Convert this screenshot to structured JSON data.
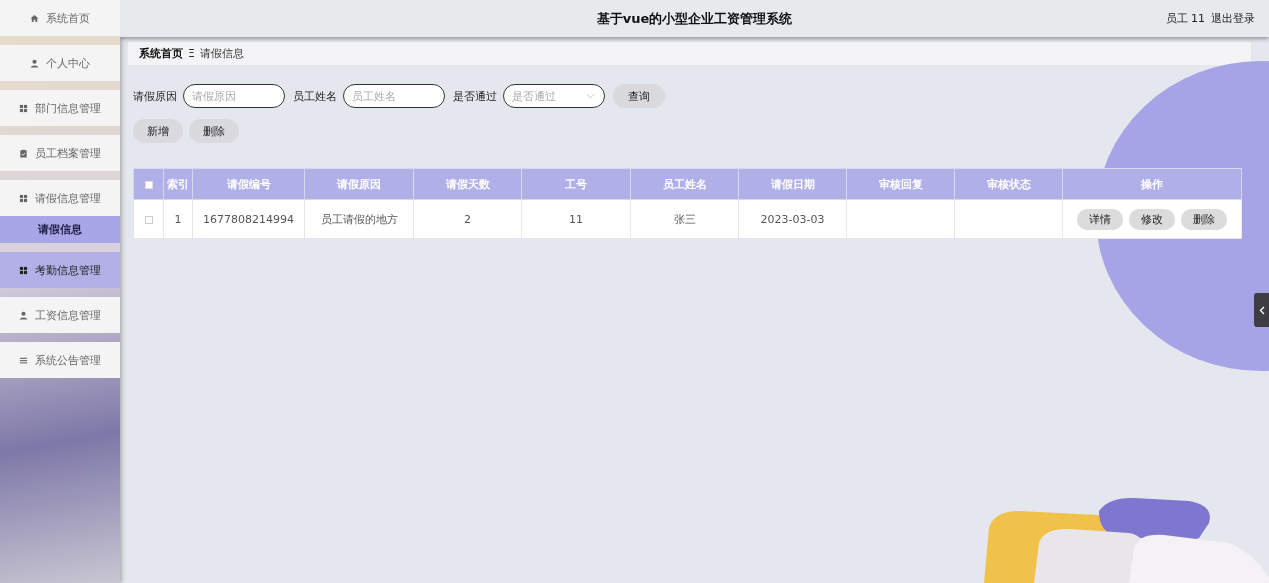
{
  "header": {
    "title": "基于vue的小型企业工资管理系统",
    "user": "员工 11",
    "logout": "退出登录"
  },
  "sidebar": {
    "items": [
      {
        "label": "系统首页",
        "kind": "home",
        "hovered": false
      },
      {
        "label": "个人中心",
        "kind": "person",
        "hovered": false
      },
      {
        "label": "部门信息管理",
        "kind": "grid",
        "hovered": false
      },
      {
        "label": "员工档案管理",
        "kind": "clipboard",
        "hovered": false
      },
      {
        "label": "请假信息管理",
        "kind": "grid",
        "hovered": false,
        "children": [
          {
            "label": "请假信息",
            "selected": true
          }
        ]
      },
      {
        "label": "考勤信息管理",
        "kind": "grid",
        "hovered": true
      },
      {
        "label": "工资信息管理",
        "kind": "person",
        "hovered": false
      },
      {
        "label": "系统公告管理",
        "kind": "list",
        "hovered": false
      }
    ]
  },
  "breadcrumb": {
    "items": [
      "系统首页",
      "请假信息"
    ],
    "separator": "Ξ"
  },
  "filters": [
    {
      "label": "请假原因",
      "kind": "text",
      "placeholder": "请假原因"
    },
    {
      "label": "员工姓名",
      "kind": "text",
      "placeholder": "员工姓名"
    },
    {
      "label": "是否通过",
      "kind": "select",
      "placeholder": "是否通过"
    }
  ],
  "search_button": "查询",
  "actions": [
    "新增",
    "删除"
  ],
  "table": {
    "all_checked": false,
    "columns": [
      "索引",
      "请假编号",
      "请假原因",
      "请假天数",
      "工号",
      "员工姓名",
      "请假日期",
      "审核回复",
      "审核状态",
      "操作"
    ],
    "rows": [
      {
        "checked": false,
        "cells": [
          "1",
          "1677808214994",
          "员工请假的地方",
          "2",
          "11",
          "张三",
          "2023-03-03",
          "",
          ""
        ],
        "buttons": [
          "详情",
          "修改",
          "删除"
        ]
      }
    ]
  }
}
